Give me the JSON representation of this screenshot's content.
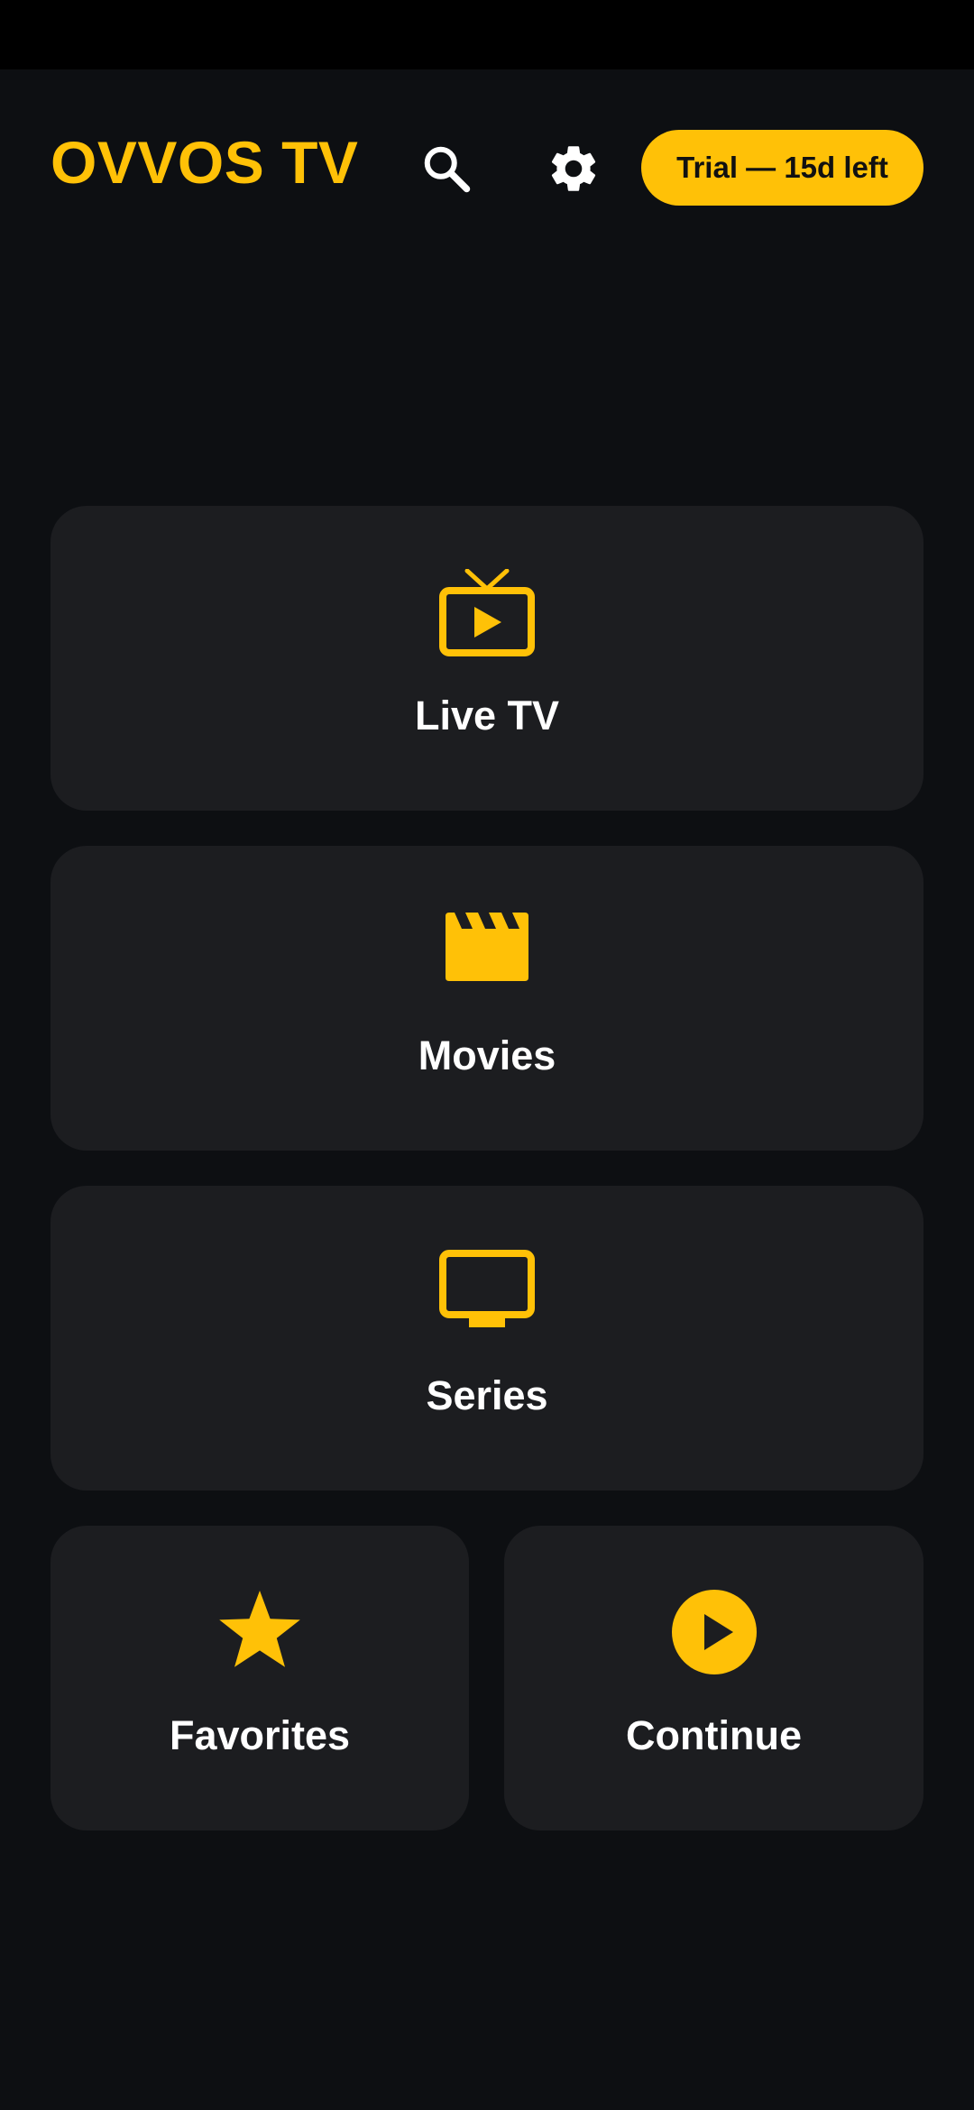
{
  "app": {
    "title": "OVVOS TV",
    "trial_label": "Trial — 15d left",
    "accent_color": "#ffc107"
  },
  "header": {
    "search_icon": "search-icon",
    "settings_icon": "gear-icon"
  },
  "cards": {
    "live_tv": {
      "label": "Live TV",
      "icon": "tv-play-icon"
    },
    "movies": {
      "label": "Movies",
      "icon": "clapperboard-icon"
    },
    "series": {
      "label": "Series",
      "icon": "monitor-icon"
    },
    "favorites": {
      "label": "Favorites",
      "icon": "star-icon"
    },
    "continue": {
      "label": "Continue",
      "icon": "play-circle-icon"
    }
  }
}
